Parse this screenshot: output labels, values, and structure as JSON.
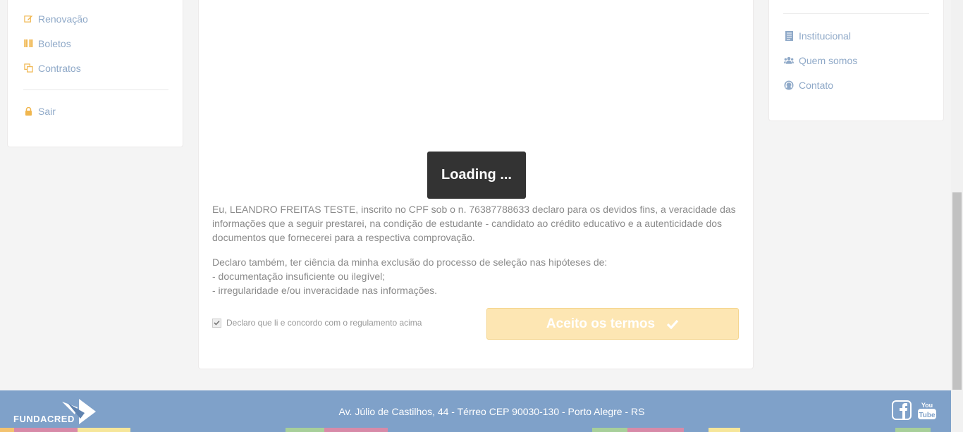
{
  "sidebar_left": {
    "items": [
      {
        "label": "Renovação",
        "icon": "edit-icon"
      },
      {
        "label": "Boletos",
        "icon": "barcode-icon"
      },
      {
        "label": "Contratos",
        "icon": "copy-icon"
      }
    ],
    "logout": {
      "label": "Sair",
      "icon": "lock-icon"
    }
  },
  "main": {
    "loading_text": "Loading ...",
    "declaration_1": "Eu, LEANDRO FREITAS TESTE, inscrito no CPF sob o n. 76387788633 declaro para os devidos fins, a veracidade das informações que a seguir prestarei, na condição de estudante - candidato ao crédito educativo e a autenticidade dos documentos que fornecerei para a respectiva comprovação.",
    "declaration_2_intro": "Declaro também, ter ciência da minha exclusão do processo de seleção nas hipóteses de:",
    "declaration_2_items": [
      "- documentação insuficiente ou ilegível;",
      "- irregularidade e/ou inveracidade nas informações."
    ],
    "checkbox_label": "Declaro que li e concordo com o regulamento acima",
    "checkbox_checked": true,
    "accept_button": "Aceito os termos"
  },
  "sidebar_right": {
    "items": [
      {
        "label": "Institucional",
        "icon": "document-icon"
      },
      {
        "label": "Quem somos",
        "icon": "users-icon"
      },
      {
        "label": "Contato",
        "icon": "headset-icon"
      }
    ]
  },
  "footer": {
    "logo_text": "FUNDACRED",
    "address": "Av. Júlio de Castilhos, 44 - Térreo CEP 90030-130 - Porto Alegre - RS",
    "social": [
      "facebook-icon",
      "youtube-icon"
    ]
  },
  "colors": {
    "link": "#8fa9c8",
    "footer": "#7fa1c9",
    "accept_button": "#fde6b3",
    "loading_bg": "#333333"
  }
}
